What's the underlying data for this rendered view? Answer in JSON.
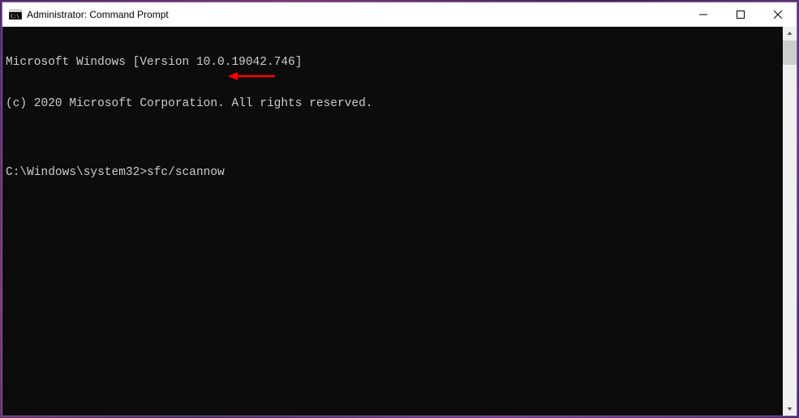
{
  "window": {
    "title": "Administrator: Command Prompt"
  },
  "terminal": {
    "line1": "Microsoft Windows [Version 10.0.19042.746]",
    "line2": "(c) 2020 Microsoft Corporation. All rights reserved.",
    "line3": "",
    "prompt": "C:\\Windows\\system32>",
    "command": "sfc/scannow"
  }
}
